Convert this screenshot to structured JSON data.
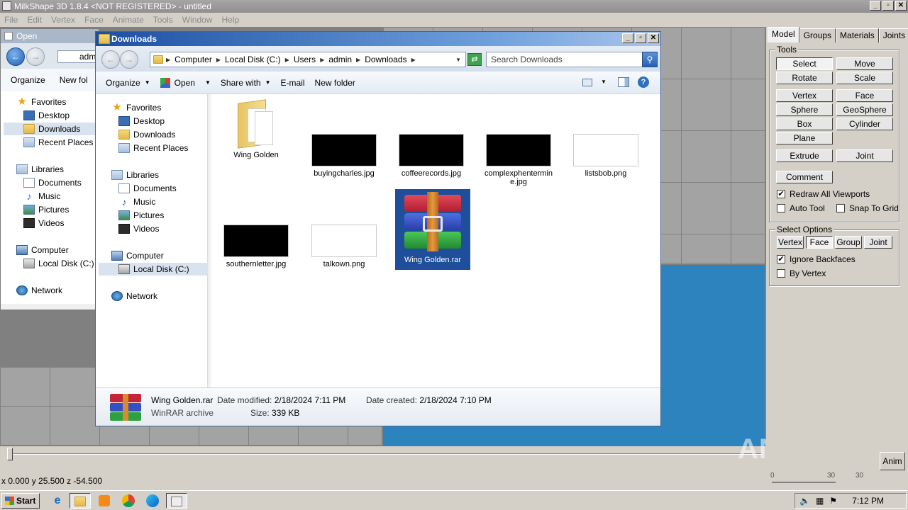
{
  "milkshape": {
    "title": "MilkShape 3D 1.8.4 <NOT REGISTERED> - untitled",
    "menu": [
      "File",
      "Edit",
      "Vertex",
      "Face",
      "Animate",
      "Tools",
      "Window",
      "Help"
    ],
    "window_controls": [
      "_",
      "▫",
      "✕"
    ],
    "coords": "x 0.000 y 25.500 z -54.500",
    "anim_button": "Anim",
    "frame_labels": [
      "0",
      "30",
      "30"
    ],
    "tabs": [
      "Model",
      "Groups",
      "Materials",
      "Joints"
    ],
    "tools_title": "Tools",
    "tools": [
      "Select",
      "Move",
      "Rotate",
      "Scale",
      "Vertex",
      "Face",
      "Sphere",
      "GeoSphere",
      "Box",
      "Cylinder",
      "Plane",
      "Extrude",
      "Joint",
      "Comment"
    ],
    "checks": [
      {
        "label": "Redraw All Viewports",
        "checked": "✔"
      },
      {
        "label": "Auto Tool",
        "checked": ""
      },
      {
        "label": "Snap To Grid",
        "checked": ""
      }
    ],
    "select_options_title": "Select Options",
    "select_buttons": [
      "Vertex",
      "Face",
      "Group",
      "Joint"
    ],
    "select_checks": [
      {
        "label": "Ignore Backfaces",
        "checked": "✔"
      },
      {
        "label": "By Vertex",
        "checked": ""
      }
    ]
  },
  "open_dialog": {
    "title": "Open",
    "addr_crumb": "adm",
    "toolbar": [
      "Organize",
      "New fol"
    ],
    "nav": [
      "Favorites",
      "Desktop",
      "Downloads",
      "Recent Places",
      "Libraries",
      "Documents",
      "Music",
      "Pictures",
      "Videos",
      "Computer",
      "Local Disk (C:)",
      "Network"
    ]
  },
  "explorer": {
    "title": "Downloads",
    "breadcrumbs": [
      "Computer",
      "Local Disk (C:)",
      "Users",
      "admin",
      "Downloads"
    ],
    "search_placeholder": "Search Downloads",
    "toolbar": {
      "organize": "Organize",
      "open": "Open",
      "share": "Share with",
      "email": "E-mail",
      "new_folder": "New folder"
    },
    "nav": [
      "Favorites",
      "Desktop",
      "Downloads",
      "Recent Places",
      "Libraries",
      "Documents",
      "Music",
      "Pictures",
      "Videos",
      "Computer",
      "Local Disk (C:)",
      "Network"
    ],
    "files": [
      {
        "name": "Wing Golden",
        "type": "folder"
      },
      {
        "name": "buyingcharles.jpg",
        "type": "black"
      },
      {
        "name": "coffeerecords.jpg",
        "type": "black"
      },
      {
        "name": "complexphentermin\ne.jpg",
        "type": "black"
      },
      {
        "name": "listsbob.png",
        "type": "white"
      },
      {
        "name": "southernletter.jpg",
        "type": "black"
      },
      {
        "name": "talkown.png",
        "type": "white"
      },
      {
        "name": "Wing Golden.rar",
        "type": "rar"
      }
    ],
    "details": {
      "name": "Wing Golden.rar",
      "kind": "WinRAR archive",
      "modified_label": "Date modified:",
      "modified": "2/18/2024 7:11 PM",
      "created_label": "Date created:",
      "created": "2/18/2024 7:10 PM",
      "size_label": "Size:",
      "size": "339 KB"
    }
  },
  "taskbar": {
    "start": "Start",
    "clock": "7:12 PM"
  },
  "watermark": "ANY.RUN"
}
